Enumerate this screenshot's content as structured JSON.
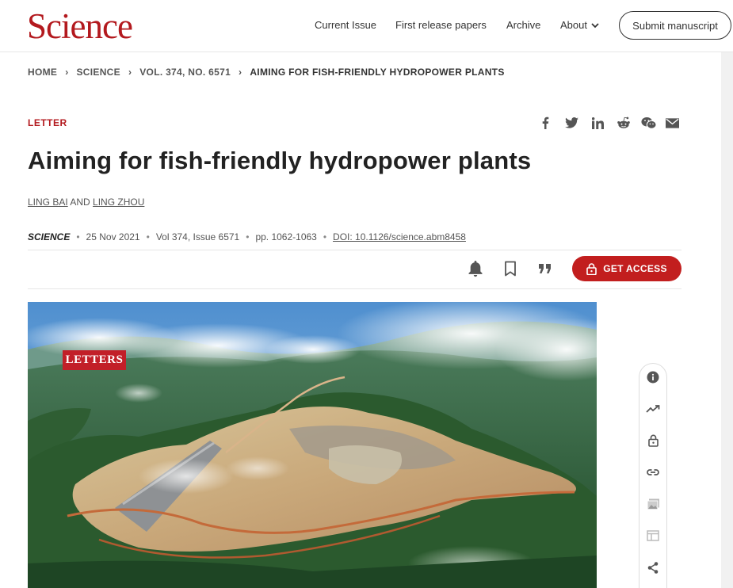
{
  "header": {
    "logo": "Science",
    "nav": [
      "Current Issue",
      "First release papers",
      "Archive",
      "About"
    ],
    "submit_label": "Submit manuscript"
  },
  "breadcrumb": [
    "HOME",
    "SCIENCE",
    "VOL. 374, NO. 6571",
    "AIMING FOR FISH-FRIENDLY HYDROPOWER PLANTS"
  ],
  "article": {
    "type": "LETTER",
    "title": "Aiming for fish-friendly hydropower plants",
    "author1": "LING BAI",
    "and": "AND",
    "author2": "LING ZHOU",
    "journal": "SCIENCE",
    "date": "25 Nov 2021",
    "volume": "Vol 374, Issue 6571",
    "pages": "pp. 1062-1063",
    "doi": "DOI: 10.1126/science.abm8458"
  },
  "share_icons": [
    "facebook-icon",
    "twitter-icon",
    "linkedin-icon",
    "reddit-icon",
    "wechat-icon",
    "email-icon"
  ],
  "actions": {
    "access_label": "GET ACCESS"
  },
  "figure": {
    "tag": "LETTERS"
  },
  "rail_icons": [
    "info-icon",
    "trending-icon",
    "lock-icon",
    "link-icon",
    "image-icon",
    "table-icon",
    "share-icon"
  ],
  "colors": {
    "brand": "#b3191e",
    "access": "#c21e1e"
  }
}
